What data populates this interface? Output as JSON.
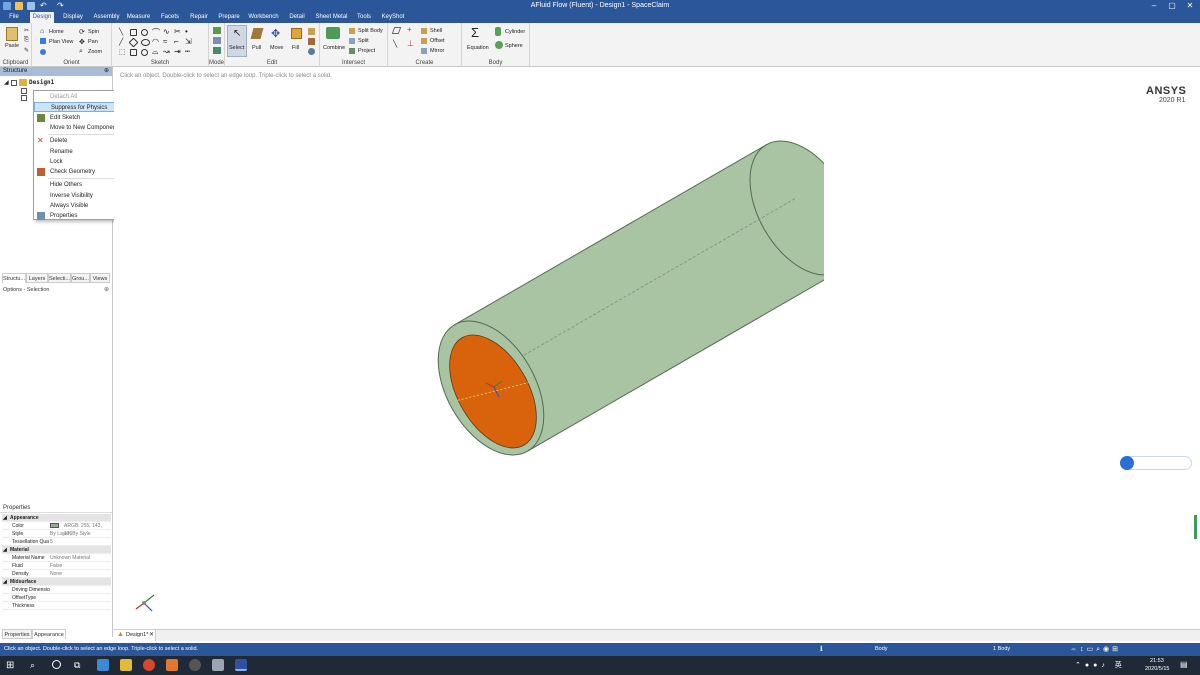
{
  "window": {
    "title": "AFluid Flow (Fluent) - Design1 - SpaceClaim"
  },
  "menu": [
    "File",
    "Design",
    "Display",
    "Assembly",
    "Measure",
    "Facets",
    "Repair",
    "Prepare",
    "Workbench",
    "Detail",
    "Sheet Metal",
    "Tools",
    "KeyShot"
  ],
  "active_menu": "Design",
  "ribbon": {
    "clipboard": {
      "label": "Clipboard",
      "paste": "Paste"
    },
    "orient": {
      "label": "Orient",
      "home": "Home",
      "plan_view": "Plan View",
      "spin": "Spin",
      "pan": "Pan",
      "zoom": "Zoom"
    },
    "sketch": {
      "label": "Sketch"
    },
    "mode": {
      "label": "Mode"
    },
    "edit": {
      "label": "Edit",
      "select": "Select",
      "pull": "Pull",
      "move": "Move",
      "fill": "Fill"
    },
    "intersect": {
      "label": "Intersect",
      "combine": "Combine",
      "split_body": "Split Body",
      "split": "Split",
      "project": "Project"
    },
    "create": {
      "label": "Create",
      "shell": "Shell",
      "offset": "Offset",
      "mirror": "Mirror"
    },
    "body": {
      "label": "Body",
      "equation": "Equation",
      "cylinder": "Cylinder",
      "sphere": "Sphere"
    }
  },
  "structure": {
    "header": "Structure",
    "tree_root": "Design1",
    "tabs": [
      "Structu...",
      "Layers",
      "Selecti...",
      "Grou...",
      "Views"
    ],
    "options_header": "Options - Selection"
  },
  "context_menu": {
    "items": [
      {
        "label": "Detach All",
        "state": "disabled"
      },
      {
        "label": "Suppress for Physics",
        "state": "highlighted"
      },
      {
        "label": "Edit Sketch",
        "state": "normal",
        "icon": "sketch-icon"
      },
      {
        "label": "Move to New Component",
        "state": "normal"
      },
      {
        "label": "Delete",
        "state": "normal",
        "icon": "delete-icon"
      },
      {
        "label": "Rename",
        "state": "normal"
      },
      {
        "label": "Lock",
        "state": "normal"
      },
      {
        "label": "Check Geometry",
        "state": "normal",
        "icon": "check-geometry-icon"
      },
      {
        "label": "Hide Others",
        "state": "normal"
      },
      {
        "label": "Inverse Visibility",
        "state": "normal"
      },
      {
        "label": "Always Visible",
        "state": "normal"
      },
      {
        "label": "Properties",
        "state": "normal",
        "icon": "properties-icon"
      }
    ]
  },
  "properties": {
    "header": "Properties",
    "rows": [
      {
        "type": "section",
        "key": "Appearance"
      },
      {
        "type": "row",
        "key": "Color",
        "value": "ARGB: 255, 143, 176"
      },
      {
        "type": "row",
        "key": "Style",
        "value": "By Layer, By Style"
      },
      {
        "type": "row",
        "key": "Tessellation Qua",
        "value": "5"
      },
      {
        "type": "section",
        "key": "Material"
      },
      {
        "type": "row",
        "key": "Material Name",
        "value": "Unknown Material"
      },
      {
        "type": "row",
        "key": "Fluid",
        "value": "False"
      },
      {
        "type": "row",
        "key": "Density",
        "value": "None"
      },
      {
        "type": "section",
        "key": "Midsurface"
      },
      {
        "type": "row",
        "key": "Driving Dimensio",
        "value": ""
      },
      {
        "type": "row",
        "key": "OffsetType",
        "value": ""
      },
      {
        "type": "row",
        "key": "Thickness",
        "value": ""
      }
    ],
    "tabs": [
      "Properties",
      "Appearance"
    ]
  },
  "viewport": {
    "hint": "Click an object. Double-click to select an edge loop. Triple-click to select a solid.",
    "brand": "ANSYS",
    "version": "2020 R1",
    "cylinder_color": "#a8c4a2",
    "face_color": "#d9620d"
  },
  "doc_tab": "Design1*",
  "status": {
    "message": "Click an object. Double-click to select an edge loop. Triple-click to select a solid.",
    "type": "Body",
    "count": "1 Body"
  },
  "taskbar": {
    "time": "21:53",
    "date": "2020/5/15"
  }
}
